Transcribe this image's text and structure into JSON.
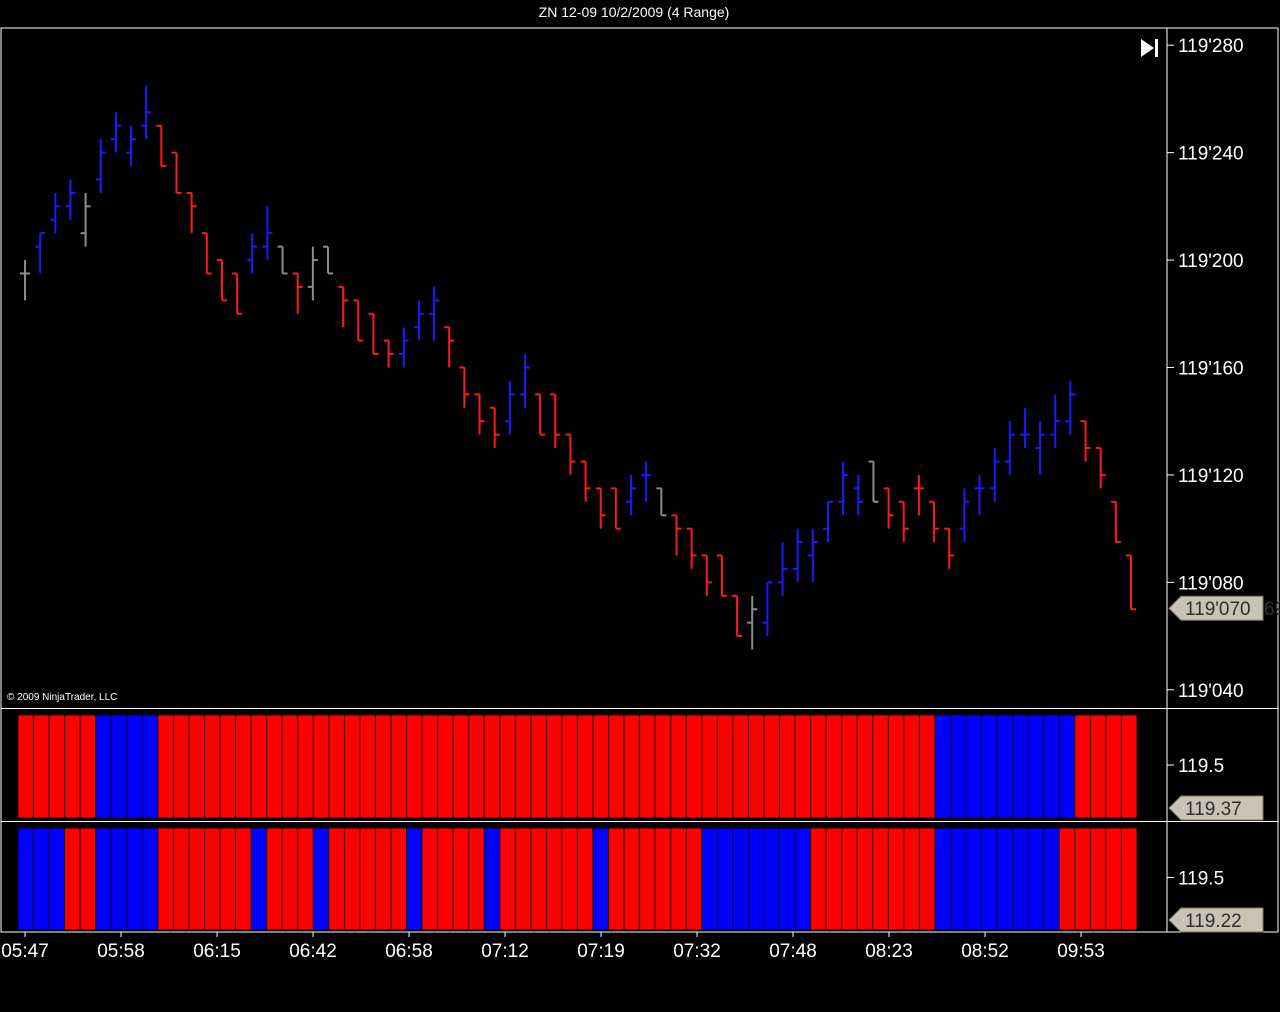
{
  "window": {
    "title": "ZN 12-09  10/2/2009 (4 Range)"
  },
  "copyright": "© 2009 NinjaTrader, LLC",
  "icons": {
    "jump_to_latest": "play-to-end-icon"
  },
  "colors": {
    "up": "#1a1aff",
    "down": "#ff1a1a",
    "neutral": "#8c8c8c",
    "histogram_up": "#0000ff",
    "histogram_down": "#ff0000"
  },
  "chart_data": [
    {
      "type": "ohlc",
      "panel": "price",
      "y_ticks": [
        "119'280",
        "119'240",
        "119'200",
        "119'160",
        "119'120",
        "119'080",
        "119'040"
      ],
      "y_tick_values": [
        119.875,
        119.75,
        119.625,
        119.5,
        119.375,
        119.25,
        119.125
      ],
      "ylim": [
        119.105,
        119.895
      ],
      "last_price_label": "119'070",
      "last_price_value": 119.21875,
      "last_price_suffix": "69",
      "bars": [
        {
          "o": 119.6094,
          "h": 119.625,
          "l": 119.5781,
          "c": 119.6094,
          "d": "n"
        },
        {
          "o": 119.6406,
          "h": 119.6563,
          "l": 119.6094,
          "c": 119.6563,
          "d": "u"
        },
        {
          "o": 119.6719,
          "h": 119.7031,
          "l": 119.6563,
          "c": 119.6875,
          "d": "u"
        },
        {
          "o": 119.6875,
          "h": 119.7188,
          "l": 119.6719,
          "c": 119.7031,
          "d": "u"
        },
        {
          "o": 119.6563,
          "h": 119.7031,
          "l": 119.6406,
          "c": 119.6875,
          "d": "n"
        },
        {
          "o": 119.7188,
          "h": 119.7656,
          "l": 119.7031,
          "c": 119.75,
          "d": "u"
        },
        {
          "o": 119.7656,
          "h": 119.7969,
          "l": 119.75,
          "c": 119.7813,
          "d": "u"
        },
        {
          "o": 119.75,
          "h": 119.7813,
          "l": 119.7344,
          "c": 119.7656,
          "d": "u"
        },
        {
          "o": 119.7813,
          "h": 119.8281,
          "l": 119.7656,
          "c": 119.7969,
          "d": "u"
        },
        {
          "o": 119.7813,
          "h": 119.7813,
          "l": 119.7344,
          "c": 119.7344,
          "d": "d"
        },
        {
          "o": 119.75,
          "h": 119.75,
          "l": 119.7031,
          "c": 119.7031,
          "d": "d"
        },
        {
          "o": 119.7031,
          "h": 119.7031,
          "l": 119.6563,
          "c": 119.6875,
          "d": "d"
        },
        {
          "o": 119.6563,
          "h": 119.6563,
          "l": 119.6094,
          "c": 119.6094,
          "d": "d"
        },
        {
          "o": 119.625,
          "h": 119.625,
          "l": 119.5781,
          "c": 119.5781,
          "d": "d"
        },
        {
          "o": 119.6094,
          "h": 119.6094,
          "l": 119.5625,
          "c": 119.5625,
          "d": "d"
        },
        {
          "o": 119.625,
          "h": 119.6563,
          "l": 119.6094,
          "c": 119.6406,
          "d": "u"
        },
        {
          "o": 119.6406,
          "h": 119.6875,
          "l": 119.625,
          "c": 119.6563,
          "d": "u"
        },
        {
          "o": 119.6406,
          "h": 119.6406,
          "l": 119.6094,
          "c": 119.6094,
          "d": "n"
        },
        {
          "o": 119.6094,
          "h": 119.6094,
          "l": 119.5625,
          "c": 119.5938,
          "d": "d"
        },
        {
          "o": 119.5938,
          "h": 119.6406,
          "l": 119.5781,
          "c": 119.625,
          "d": "n"
        },
        {
          "o": 119.6406,
          "h": 119.6406,
          "l": 119.6094,
          "c": 119.6094,
          "d": "n"
        },
        {
          "o": 119.5938,
          "h": 119.5938,
          "l": 119.5469,
          "c": 119.5781,
          "d": "d"
        },
        {
          "o": 119.5781,
          "h": 119.5781,
          "l": 119.5313,
          "c": 119.5313,
          "d": "d"
        },
        {
          "o": 119.5625,
          "h": 119.5625,
          "l": 119.5156,
          "c": 119.5156,
          "d": "d"
        },
        {
          "o": 119.5313,
          "h": 119.5313,
          "l": 119.5,
          "c": 119.5156,
          "d": "d"
        },
        {
          "o": 119.5156,
          "h": 119.5469,
          "l": 119.5,
          "c": 119.5313,
          "d": "u"
        },
        {
          "o": 119.5469,
          "h": 119.5781,
          "l": 119.5313,
          "c": 119.5625,
          "d": "u"
        },
        {
          "o": 119.5625,
          "h": 119.5938,
          "l": 119.5313,
          "c": 119.5781,
          "d": "u"
        },
        {
          "o": 119.5469,
          "h": 119.5469,
          "l": 119.5,
          "c": 119.5313,
          "d": "d"
        },
        {
          "o": 119.5,
          "h": 119.5,
          "l": 119.4531,
          "c": 119.4688,
          "d": "d"
        },
        {
          "o": 119.4688,
          "h": 119.4688,
          "l": 119.4219,
          "c": 119.4375,
          "d": "d"
        },
        {
          "o": 119.4531,
          "h": 119.4531,
          "l": 119.4063,
          "c": 119.4219,
          "d": "d"
        },
        {
          "o": 119.4375,
          "h": 119.4844,
          "l": 119.4219,
          "c": 119.4688,
          "d": "u"
        },
        {
          "o": 119.4688,
          "h": 119.5156,
          "l": 119.4531,
          "c": 119.5,
          "d": "u"
        },
        {
          "o": 119.4688,
          "h": 119.4688,
          "l": 119.4219,
          "c": 119.4219,
          "d": "d"
        },
        {
          "o": 119.4688,
          "h": 119.4688,
          "l": 119.4063,
          "c": 119.4219,
          "d": "d"
        },
        {
          "o": 119.4219,
          "h": 119.4219,
          "l": 119.375,
          "c": 119.3906,
          "d": "d"
        },
        {
          "o": 119.3906,
          "h": 119.3906,
          "l": 119.3438,
          "c": 119.3594,
          "d": "d"
        },
        {
          "o": 119.3594,
          "h": 119.3594,
          "l": 119.3125,
          "c": 119.3281,
          "d": "d"
        },
        {
          "o": 119.3594,
          "h": 119.3594,
          "l": 119.3125,
          "c": 119.3125,
          "d": "d"
        },
        {
          "o": 119.3438,
          "h": 119.375,
          "l": 119.3281,
          "c": 119.3594,
          "d": "u"
        },
        {
          "o": 119.375,
          "h": 119.3906,
          "l": 119.3438,
          "c": 119.375,
          "d": "u"
        },
        {
          "o": 119.3594,
          "h": 119.3594,
          "l": 119.3281,
          "c": 119.3281,
          "d": "n"
        },
        {
          "o": 119.3281,
          "h": 119.3281,
          "l": 119.2813,
          "c": 119.3125,
          "d": "d"
        },
        {
          "o": 119.3125,
          "h": 119.3125,
          "l": 119.2656,
          "c": 119.2813,
          "d": "d"
        },
        {
          "o": 119.2813,
          "h": 119.2813,
          "l": 119.2344,
          "c": 119.25,
          "d": "d"
        },
        {
          "o": 119.2813,
          "h": 119.2813,
          "l": 119.2344,
          "c": 119.2344,
          "d": "d"
        },
        {
          "o": 119.2344,
          "h": 119.2344,
          "l": 119.1875,
          "c": 119.1875,
          "d": "d"
        },
        {
          "o": 119.2031,
          "h": 119.2344,
          "l": 119.1719,
          "c": 119.2188,
          "d": "n"
        },
        {
          "o": 119.2031,
          "h": 119.25,
          "l": 119.1875,
          "c": 119.25,
          "d": "u"
        },
        {
          "o": 119.25,
          "h": 119.2969,
          "l": 119.2344,
          "c": 119.2656,
          "d": "u"
        },
        {
          "o": 119.2656,
          "h": 119.3125,
          "l": 119.25,
          "c": 119.2969,
          "d": "u"
        },
        {
          "o": 119.2813,
          "h": 119.3125,
          "l": 119.25,
          "c": 119.2969,
          "d": "u"
        },
        {
          "o": 119.3125,
          "h": 119.3438,
          "l": 119.2969,
          "c": 119.3438,
          "d": "u"
        },
        {
          "o": 119.3438,
          "h": 119.3906,
          "l": 119.3281,
          "c": 119.375,
          "d": "u"
        },
        {
          "o": 119.3594,
          "h": 119.375,
          "l": 119.3281,
          "c": 119.3438,
          "d": "u"
        },
        {
          "o": 119.3906,
          "h": 119.3906,
          "l": 119.3438,
          "c": 119.3438,
          "d": "n"
        },
        {
          "o": 119.3594,
          "h": 119.3594,
          "l": 119.3125,
          "c": 119.3281,
          "d": "d"
        },
        {
          "o": 119.3438,
          "h": 119.3438,
          "l": 119.2969,
          "c": 119.3125,
          "d": "d"
        },
        {
          "o": 119.3594,
          "h": 119.375,
          "l": 119.3281,
          "c": 119.3594,
          "d": "d"
        },
        {
          "o": 119.3438,
          "h": 119.3438,
          "l": 119.2969,
          "c": 119.3125,
          "d": "d"
        },
        {
          "o": 119.3125,
          "h": 119.3125,
          "l": 119.2656,
          "c": 119.2813,
          "d": "d"
        },
        {
          "o": 119.3125,
          "h": 119.3594,
          "l": 119.2969,
          "c": 119.3438,
          "d": "u"
        },
        {
          "o": 119.3594,
          "h": 119.375,
          "l": 119.3281,
          "c": 119.3594,
          "d": "u"
        },
        {
          "o": 119.3594,
          "h": 119.4063,
          "l": 119.3438,
          "c": 119.3906,
          "d": "u"
        },
        {
          "o": 119.3906,
          "h": 119.4375,
          "l": 119.375,
          "c": 119.4219,
          "d": "u"
        },
        {
          "o": 119.4219,
          "h": 119.4531,
          "l": 119.4063,
          "c": 119.4219,
          "d": "u"
        },
        {
          "o": 119.4063,
          "h": 119.4375,
          "l": 119.375,
          "c": 119.4219,
          "d": "u"
        },
        {
          "o": 119.4219,
          "h": 119.4688,
          "l": 119.4063,
          "c": 119.4375,
          "d": "u"
        },
        {
          "o": 119.4375,
          "h": 119.4844,
          "l": 119.4219,
          "c": 119.4688,
          "d": "u"
        },
        {
          "o": 119.4375,
          "h": 119.4375,
          "l": 119.3906,
          "c": 119.4063,
          "d": "d"
        },
        {
          "o": 119.4063,
          "h": 119.4063,
          "l": 119.3594,
          "c": 119.375,
          "d": "d"
        },
        {
          "o": 119.3438,
          "h": 119.3438,
          "l": 119.2969,
          "c": 119.2969,
          "d": "d"
        },
        {
          "o": 119.2813,
          "h": 119.2813,
          "l": 119.2188,
          "c": 119.2188,
          "d": "d"
        }
      ]
    },
    {
      "type": "bar",
      "panel": "indicator-1",
      "y_ticks": [
        "119.5"
      ],
      "ylim": [
        119.3,
        119.7
      ],
      "last_value_label": "119.37",
      "colors": [
        "r",
        "r",
        "r",
        "r",
        "r",
        "b",
        "b",
        "b",
        "b",
        "r",
        "r",
        "r",
        "r",
        "r",
        "r",
        "r",
        "r",
        "r",
        "r",
        "r",
        "r",
        "r",
        "r",
        "r",
        "r",
        "r",
        "r",
        "r",
        "r",
        "r",
        "r",
        "r",
        "r",
        "r",
        "r",
        "r",
        "r",
        "r",
        "r",
        "r",
        "r",
        "r",
        "r",
        "r",
        "r",
        "r",
        "r",
        "r",
        "r",
        "r",
        "r",
        "r",
        "r",
        "r",
        "r",
        "r",
        "r",
        "r",
        "r",
        "b",
        "b",
        "b",
        "b",
        "b",
        "b",
        "b",
        "b",
        "b",
        "r",
        "r",
        "r",
        "r"
      ]
    },
    {
      "type": "bar",
      "panel": "indicator-2",
      "y_ticks": [
        "119.5"
      ],
      "ylim": [
        119.3,
        119.7
      ],
      "last_value_label": "119.22",
      "colors": [
        "b",
        "b",
        "b",
        "r",
        "r",
        "b",
        "b",
        "b",
        "b",
        "r",
        "r",
        "r",
        "r",
        "r",
        "r",
        "b",
        "r",
        "r",
        "r",
        "b",
        "r",
        "r",
        "r",
        "r",
        "r",
        "b",
        "r",
        "r",
        "r",
        "r",
        "b",
        "r",
        "r",
        "r",
        "r",
        "r",
        "r",
        "b",
        "r",
        "r",
        "r",
        "r",
        "r",
        "r",
        "b",
        "b",
        "b",
        "b",
        "b",
        "b",
        "b",
        "r",
        "r",
        "r",
        "r",
        "r",
        "r",
        "r",
        "r",
        "b",
        "b",
        "b",
        "b",
        "b",
        "b",
        "b",
        "b",
        "r",
        "r",
        "r",
        "r",
        "r"
      ]
    }
  ],
  "x_axis": {
    "ticks": [
      "05:47",
      "05:58",
      "06:15",
      "06:42",
      "06:58",
      "07:12",
      "07:19",
      "07:32",
      "07:48",
      "08:23",
      "08:52",
      "09:53"
    ]
  }
}
